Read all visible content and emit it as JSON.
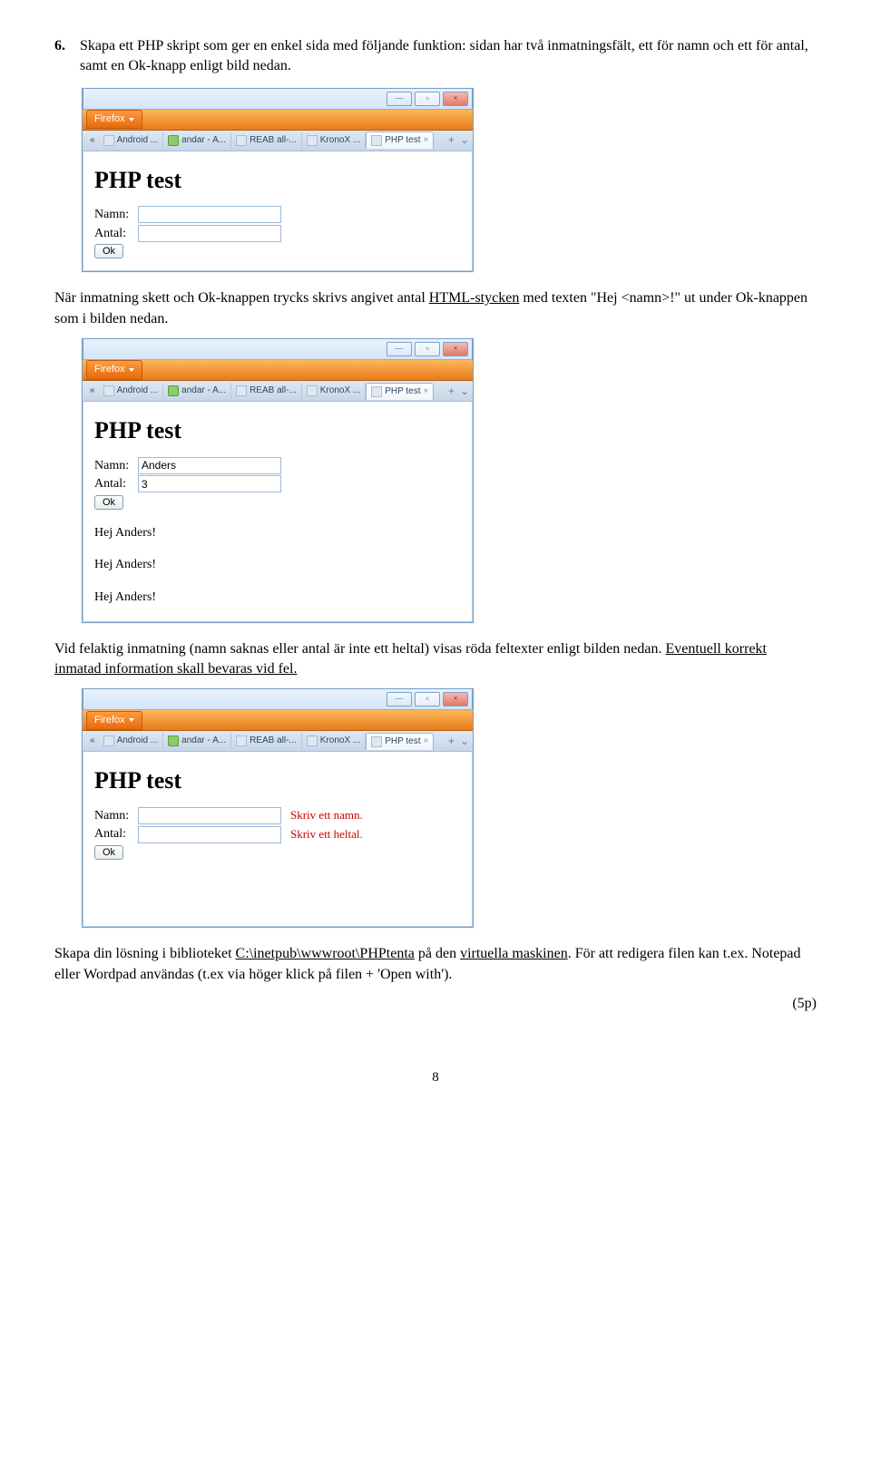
{
  "question_number": "6.",
  "question_text": "Skapa ett PHP skript som ger en enkel sida med följande funktion: sidan har två inmatningsfält, ett för namn och ett för antal, samt en Ok-knapp enligt bild nedan.",
  "para_text_before_html": "När inmatning skett och Ok-knappen trycks skrivs angivet antal ",
  "html_word": "HTML-stycken",
  "para_text_mid": " med texten \"Hej <namn>!\" ut under Ok-knappen som i bilden nedan.",
  "para_error_before": "Vid felaktig inmatning (namn saknas eller antal är inte ett heltal) visas röda feltexter enligt bilden nedan. ",
  "para_error_underline": "Eventuell korrekt inmatad information skall bevaras vid fel.",
  "solution_text_before": "Skapa din lösning i biblioteket ",
  "solution_path": "C:\\inetpub\\wwwroot\\PHPtenta",
  "solution_text_mid": " på den ",
  "solution_virtual": "virtuella maskinen",
  "solution_text_after": ". För att redigera filen kan t.ex. Notepad eller Wordpad användas (t.ex via höger klick på filen + 'Open with').",
  "score": "(5p)",
  "page_number": "8",
  "browser": {
    "firefox_label": "Firefox",
    "tabs": [
      "Android ...",
      "andar - A...",
      "REAB all-...",
      "KronoX ...",
      "PHP test"
    ],
    "min": "—",
    "max": "▫",
    "close": "×",
    "tab_plus": "+",
    "tab_arrow": "⌄"
  },
  "form": {
    "title": "PHP test",
    "namn_label": "Namn:",
    "antal_label": "Antal:",
    "ok_label": "Ok"
  },
  "shot2": {
    "namn_value": "Anders",
    "antal_value": "3",
    "greeting": "Hej Anders!"
  },
  "shot3": {
    "err_namn": "Skriv ett namn.",
    "err_antal": "Skriv ett heltal."
  }
}
